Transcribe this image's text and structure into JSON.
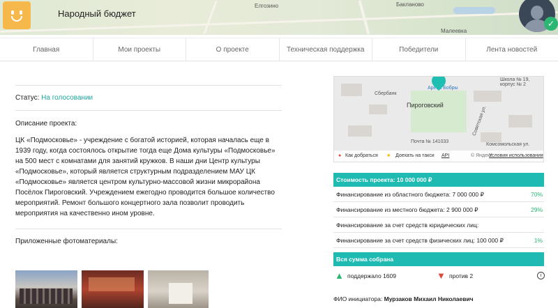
{
  "header": {
    "site_title": "Народный бюджет",
    "map_labels": [
      "Елгозино",
      "Бакланово",
      "Малеевка"
    ]
  },
  "nav": {
    "items": [
      {
        "label": "Главная"
      },
      {
        "label": "Мои проекты"
      },
      {
        "label": "О проекте"
      },
      {
        "label": "Техническая поддержка"
      },
      {
        "label": "Победители"
      },
      {
        "label": "Лента новостей"
      }
    ]
  },
  "project": {
    "status_label": "Статус:",
    "status_value": "На голосовании",
    "description_label": "Описание проекта:",
    "description": "ЦК «Подмосковье» - учреждение с богатой историей, которая началась еще в 1939 году, когда состоялось открытие тогда еще Дома культуры «Подмосковье» на 500 мест с комнатами для занятий кружков. В наши дни Центр культуры «Подмосковье», который является структурным подразделением МАУ ЦК «Подмосковье» является центром культурно-массовой жизни микрорайона Посёлок Пироговский. Учреждением ежегодно проводится большое количество мероприятий. Ремонт большого концертного зала позволит проводить мероприятия на качественно ином уровне.",
    "photos_label": "Приложенные фотоматериалы:"
  },
  "map": {
    "labels": [
      "Школа № 19, корпус № 2",
      "Арена Бобры",
      "Сбербанк",
      "Пироговский",
      "Почта № 141033",
      "Советская ул.",
      "Комсомольская ул."
    ],
    "route_label": "Как добраться",
    "taxi_label": "Доехать на такси",
    "api_label": "API",
    "copyright": "© Яндекс",
    "terms_label": "Условия использования"
  },
  "funding": {
    "total": "Стоимость проекта: 10 000 000 ₽",
    "rows": [
      {
        "label": "Финансирование из областного бюджета: 7 000 000 ₽",
        "pct": "70%"
      },
      {
        "label": "Финансирование из местного бюджета: 2 900 000 ₽",
        "pct": "29%"
      },
      {
        "label": "Финансирование за счет средств юридических лиц:",
        "pct": ""
      },
      {
        "label": "Финансирование за счет средств физических лиц: 100 000 ₽",
        "pct": "1%"
      }
    ],
    "collected": "Вся сумма собрана"
  },
  "votes": {
    "support": "поддержало 1609",
    "against": "против 2",
    "info_icon": "info-icon"
  },
  "initiator": {
    "label": "ФИО инициатора:",
    "name": "Мурзаков Михаил Николаевич"
  },
  "colors": {
    "accent": "#1fbbb3",
    "positive": "#2bb673",
    "negative": "#e0483c",
    "logo": "#f6b84a"
  }
}
